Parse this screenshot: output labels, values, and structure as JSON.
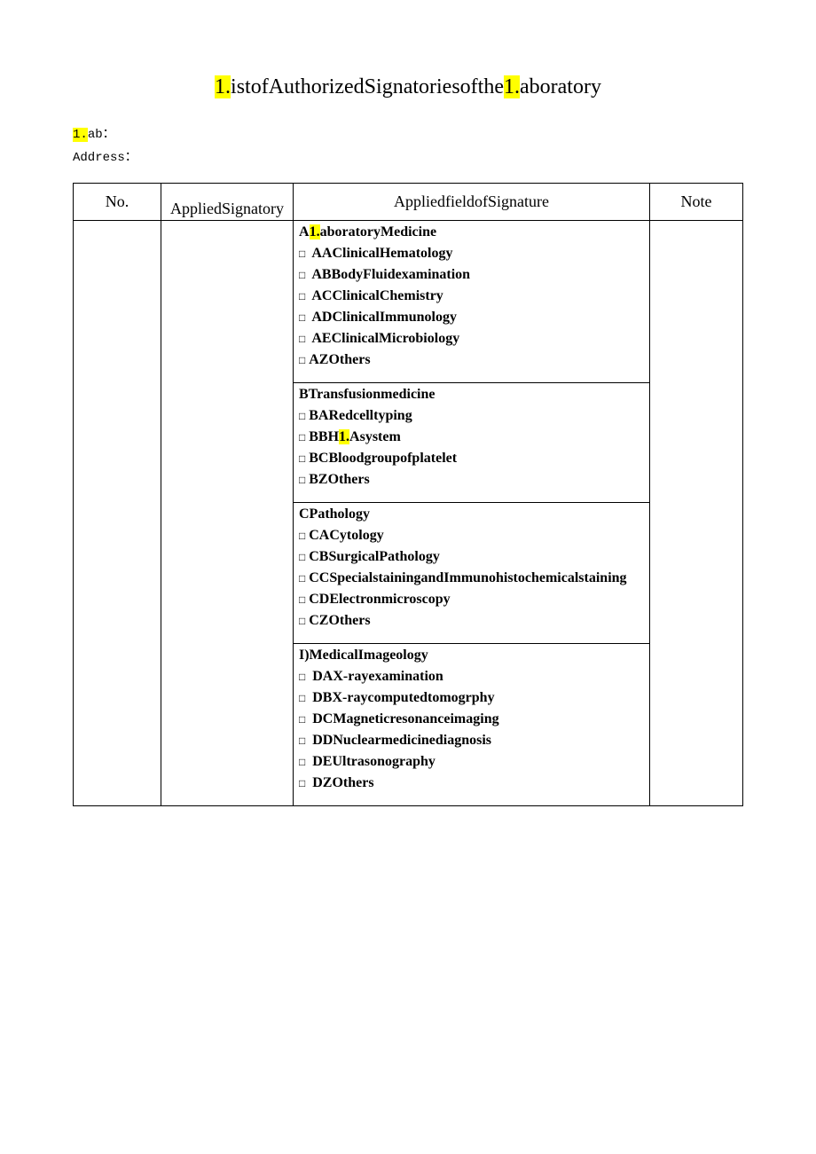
{
  "title_parts": [
    "1.",
    "istofAuthorizedSignatoriesofthe",
    "1.",
    "aboratory"
  ],
  "labels": {
    "lab_prefix": "1.",
    "lab_suffix": "ab：",
    "address": "Address："
  },
  "headers": {
    "no": "No.",
    "signatory": "AppliedSignatory",
    "field": "AppliedfieldofSignature",
    "note": "Note"
  },
  "sections": [
    {
      "title_parts": [
        "A",
        "1.",
        "aboratoryMedicine"
      ],
      "title_highlight_index": 1,
      "items": [
        {
          "cb": "□",
          "bold": true,
          "spaced": true,
          "text": "AAClinicalHematology"
        },
        {
          "cb": "□",
          "bold": true,
          "spaced": true,
          "text": "ABBodyFluidexamination"
        },
        {
          "cb": "□",
          "bold": true,
          "spaced": true,
          "text": "ACClinicalChemistry"
        },
        {
          "cb": "□",
          "bold": true,
          "spaced": true,
          "text": "ADClinicalImmunology"
        },
        {
          "cb": "□",
          "bold": true,
          "spaced": true,
          "text": "AEClinicalMicrobiology"
        },
        {
          "cb": "□",
          "bold": true,
          "spaced": false,
          "text": "AZOthers"
        }
      ]
    },
    {
      "title": "BTransfusionmedicine",
      "items": [
        {
          "cb": "□",
          "bold": true,
          "spaced": false,
          "text": "BARedcelltyping"
        },
        {
          "cb": "□",
          "bold": true,
          "spaced": false,
          "parts": [
            "BBH",
            "1.",
            "Asystem"
          ],
          "hl_index": 1
        },
        {
          "cb": "□",
          "bold": true,
          "spaced": false,
          "text": "BCBloodgroupofplatelet"
        },
        {
          "cb": "□",
          "bold": true,
          "spaced": false,
          "text": "BZOthers"
        }
      ]
    },
    {
      "title": "CPathology",
      "items": [
        {
          "cb": "□",
          "bold": true,
          "spaced": false,
          "text": "CACytology"
        },
        {
          "cb": "□",
          "bold": true,
          "spaced": false,
          "text": "CBSurgicalPathology"
        },
        {
          "cb": "□",
          "bold": true,
          "spaced": false,
          "text": "CCSpecialstainingandImmunohistochemicalstaining"
        },
        {
          "cb": "□",
          "bold": true,
          "spaced": false,
          "text": "CDElectronmicroscopy"
        },
        {
          "cb": "□",
          "bold": true,
          "spaced": false,
          "text": "CZOthers"
        }
      ]
    },
    {
      "title": "I)MedicalImageology",
      "items": [
        {
          "cb": "□",
          "bold": true,
          "spaced": true,
          "text": "DAX-rayexamination"
        },
        {
          "cb": "□",
          "bold": true,
          "spaced": true,
          "text": "DBX-raycomputedtomogrphy"
        },
        {
          "cb": "□",
          "bold": true,
          "spaced": true,
          "text": "DCMagneticresonanceimaging"
        },
        {
          "cb": "□",
          "bold": true,
          "spaced": true,
          "text": "DDNuclearmedicinediagnosis"
        },
        {
          "cb": "□",
          "bold": true,
          "spaced": true,
          "text": "DEUltrasonography"
        },
        {
          "cb": "□",
          "bold": true,
          "spaced": true,
          "text": "DZOthers"
        }
      ]
    }
  ]
}
